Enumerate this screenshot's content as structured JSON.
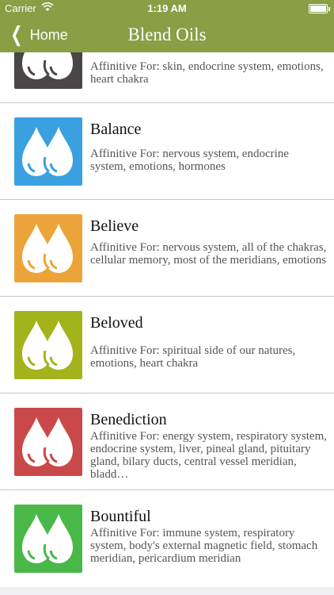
{
  "status": {
    "carrier": "Carrier",
    "time": "1:19 AM"
  },
  "nav": {
    "back_label": "Home",
    "title": "Blend Oils"
  },
  "rows": [
    {
      "title": "",
      "desc": "Affinitive For:  skin, endocrine system, emotions, heart chakra",
      "color": "#4a4645"
    },
    {
      "title": "Balance",
      "desc": "Affinitive For: nervous system, endocrine system, emotions, hormones",
      "color": "#3aa0e0"
    },
    {
      "title": "Believe",
      "desc": "Affinitive For:  nervous system, all of the chakras, cellular memory, most of the meridians, emotions",
      "color": "#eca43a"
    },
    {
      "title": "Beloved",
      "desc": "Affinitive For: spiritual side of our natures, emotions, heart chakra",
      "color": "#a3b31c"
    },
    {
      "title": "Benediction",
      "desc": "Affinitive For:  energy system, respiratory system, endocrine system, liver, pineal gland, pituitary gland, bilary ducts, central vessel meridian, bladd…",
      "color": "#c9494b"
    },
    {
      "title": "Bountiful",
      "desc": "Affinitive For: immune system, respiratory system, body's external magnetic field, stomach meridian, pericardium meridian",
      "color": "#49b848"
    }
  ]
}
